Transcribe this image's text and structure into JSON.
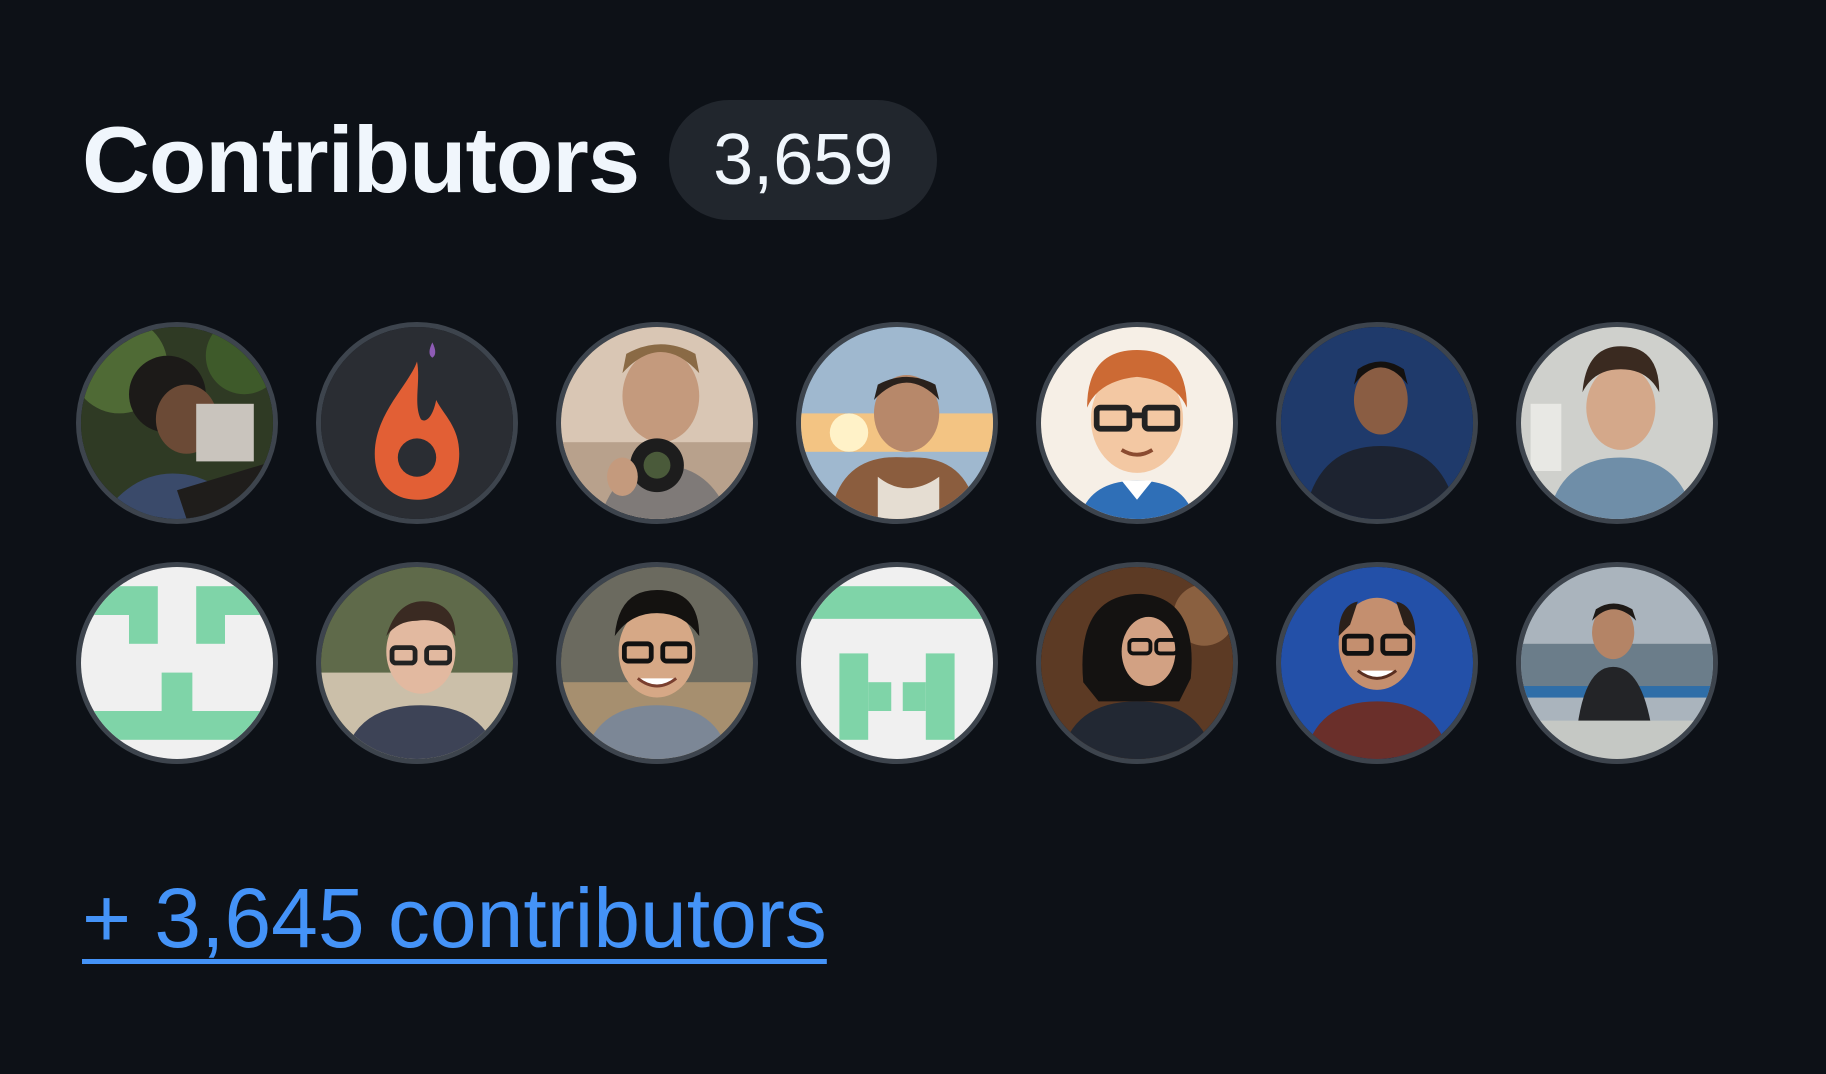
{
  "section": {
    "title": "Contributors",
    "count": "3,659"
  },
  "avatars": [
    {
      "icon": "contributor-avatar-photo"
    },
    {
      "icon": "flame-logo-avatar"
    },
    {
      "icon": "contributor-avatar-photo"
    },
    {
      "icon": "contributor-avatar-photo"
    },
    {
      "icon": "cartoon-avatar"
    },
    {
      "icon": "contributor-avatar-photo"
    },
    {
      "icon": "contributor-avatar-photo"
    },
    {
      "icon": "identicon-avatar"
    },
    {
      "icon": "contributor-avatar-photo"
    },
    {
      "icon": "contributor-avatar-photo"
    },
    {
      "icon": "identicon-avatar"
    },
    {
      "icon": "contributor-avatar-photo"
    },
    {
      "icon": "contributor-avatar-photo"
    },
    {
      "icon": "contributor-avatar-photo"
    }
  ],
  "more_link": {
    "label": "+ 3,645 contributors"
  },
  "colors": {
    "background": "#0d1117",
    "text": "#f0f6fc",
    "badge_bg": "#21262d",
    "link": "#4493f8",
    "identicon": "#7fd4a8"
  }
}
